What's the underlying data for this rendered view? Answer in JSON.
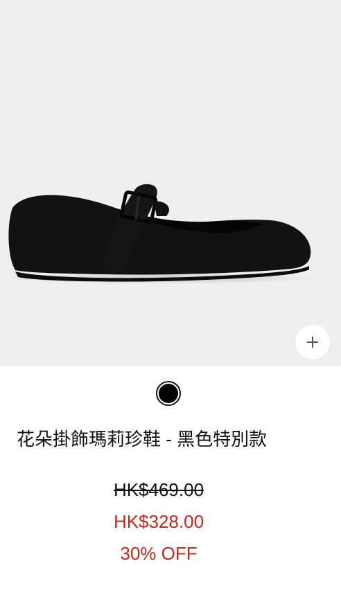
{
  "product": {
    "title": "花朵掛飾瑪莉珍鞋 - 黑色特別款",
    "original_price": "HK$469.00",
    "sale_price": "HK$328.00",
    "discount": "30% OFF",
    "image_alt": "Black Mary Jane flat shoe"
  },
  "colors": {
    "image_background": "#efeff0",
    "sale": "#c0291c",
    "swatch_selected": "#000000"
  },
  "icons": {
    "zoom": "plus-icon"
  }
}
